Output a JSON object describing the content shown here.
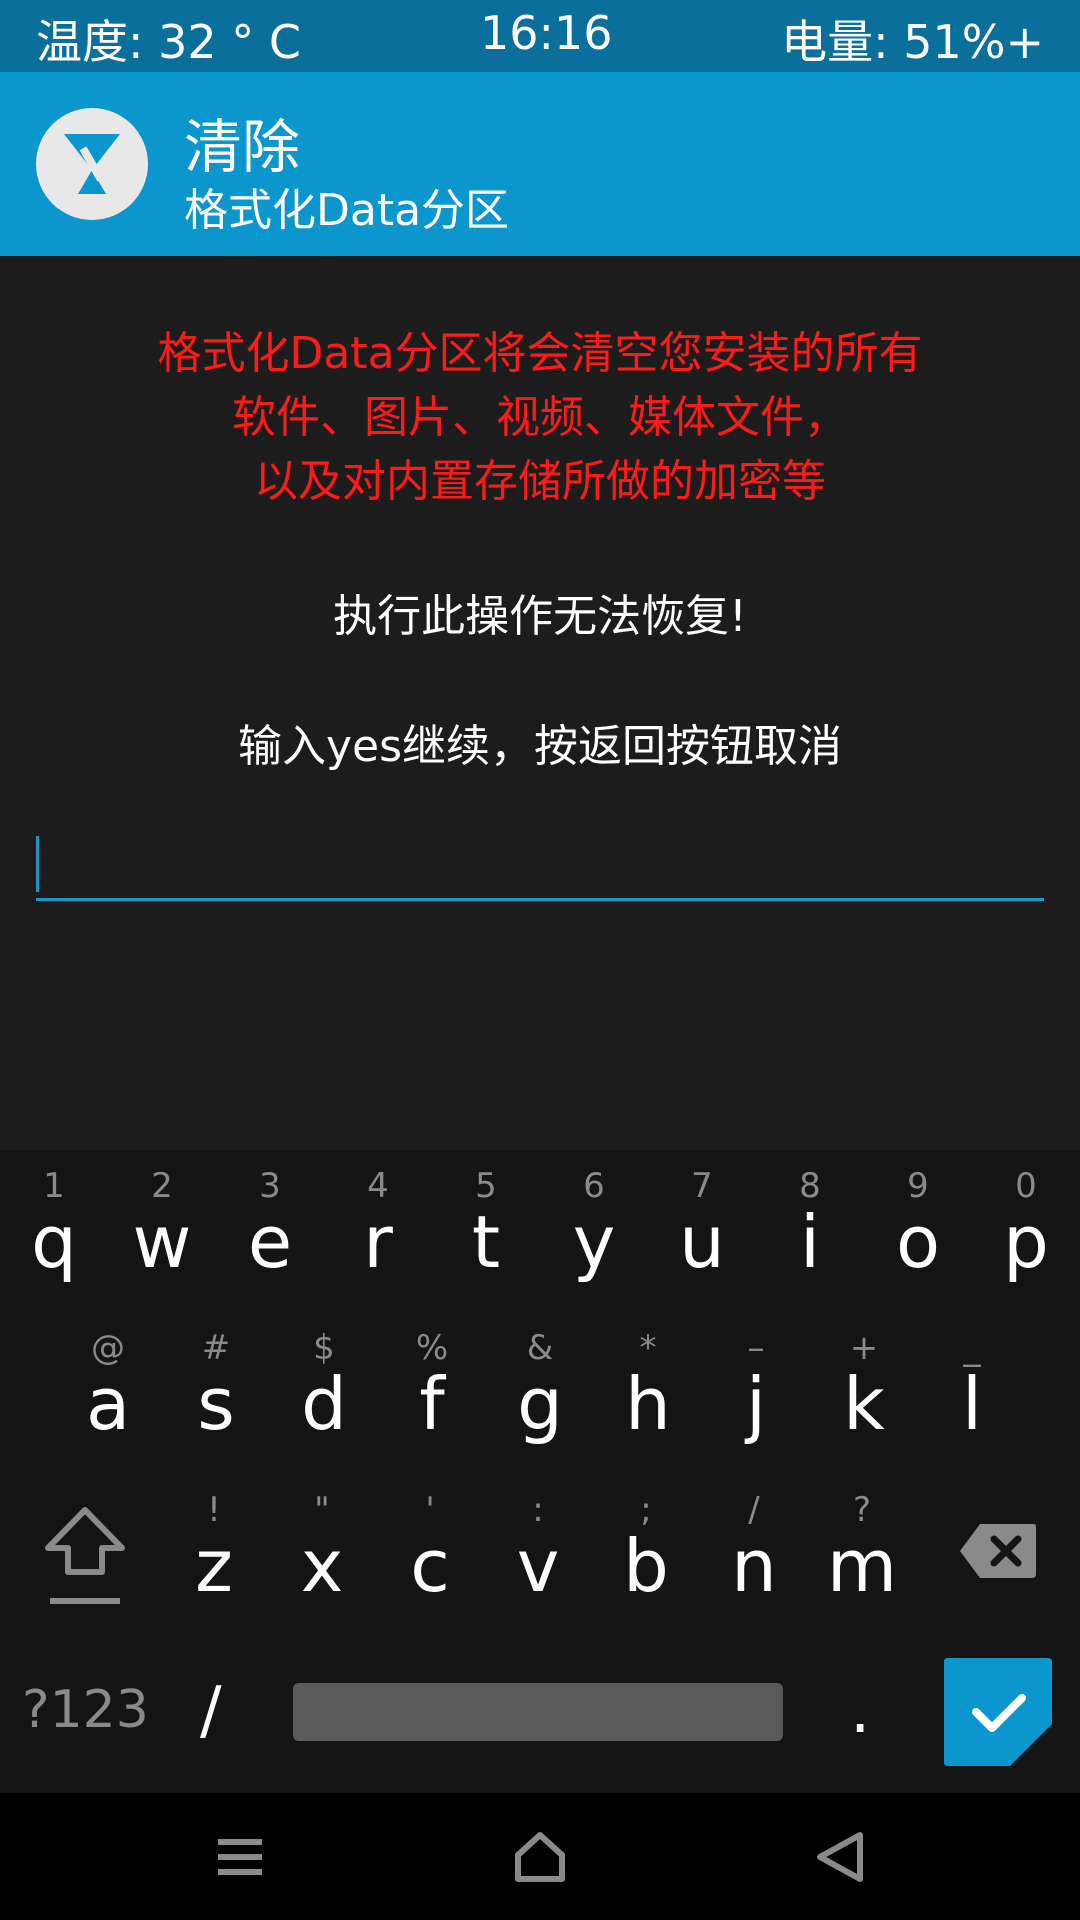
{
  "status_bar": {
    "temperature": "温度: 32 ° C",
    "time": "16:16",
    "battery": "电量: 51%+"
  },
  "header": {
    "title": "清除",
    "subtitle": "格式化Data分区",
    "logo_icon": "twrp-logo-icon"
  },
  "warning": {
    "lines": [
      "格式化Data分区将会清空您安装的所有",
      "软件、图片、视频、媒体文件，",
      "以及对内置存储所做的加密等"
    ],
    "color": "#ff1a1a"
  },
  "notice": "执行此操作无法恢复!",
  "instruction": "输入yes继续，按返回按钮取消",
  "input": {
    "value": "",
    "accent": "#1e94c8"
  },
  "keyboard": {
    "row1": [
      {
        "main": "q",
        "hint": "1"
      },
      {
        "main": "w",
        "hint": "2"
      },
      {
        "main": "e",
        "hint": "3"
      },
      {
        "main": "r",
        "hint": "4"
      },
      {
        "main": "t",
        "hint": "5"
      },
      {
        "main": "y",
        "hint": "6"
      },
      {
        "main": "u",
        "hint": "7"
      },
      {
        "main": "i",
        "hint": "8"
      },
      {
        "main": "o",
        "hint": "9"
      },
      {
        "main": "p",
        "hint": "0"
      }
    ],
    "row2": [
      {
        "main": "a",
        "hint": "@"
      },
      {
        "main": "s",
        "hint": "#"
      },
      {
        "main": "d",
        "hint": "$"
      },
      {
        "main": "f",
        "hint": "%"
      },
      {
        "main": "g",
        "hint": "&"
      },
      {
        "main": "h",
        "hint": "*"
      },
      {
        "main": "j",
        "hint": "–"
      },
      {
        "main": "k",
        "hint": "+"
      },
      {
        "main": "l",
        "hint": "_"
      }
    ],
    "row3": [
      {
        "main": "z",
        "hint": "!"
      },
      {
        "main": "x",
        "hint": "\""
      },
      {
        "main": "c",
        "hint": "'"
      },
      {
        "main": "v",
        "hint": ":"
      },
      {
        "main": "b",
        "hint": ";"
      },
      {
        "main": "n",
        "hint": "/"
      },
      {
        "main": "m",
        "hint": "?"
      }
    ],
    "symbols_label": "?123",
    "slash_label": "/",
    "period_label": ".",
    "shift_icon": "shift-icon",
    "backspace_icon": "backspace-icon",
    "enter_icon": "checkmark-icon",
    "enter_color": "#0b96cd"
  },
  "navbar": {
    "menu_icon": "menu-icon",
    "home_icon": "home-icon",
    "back_icon": "back-icon"
  }
}
